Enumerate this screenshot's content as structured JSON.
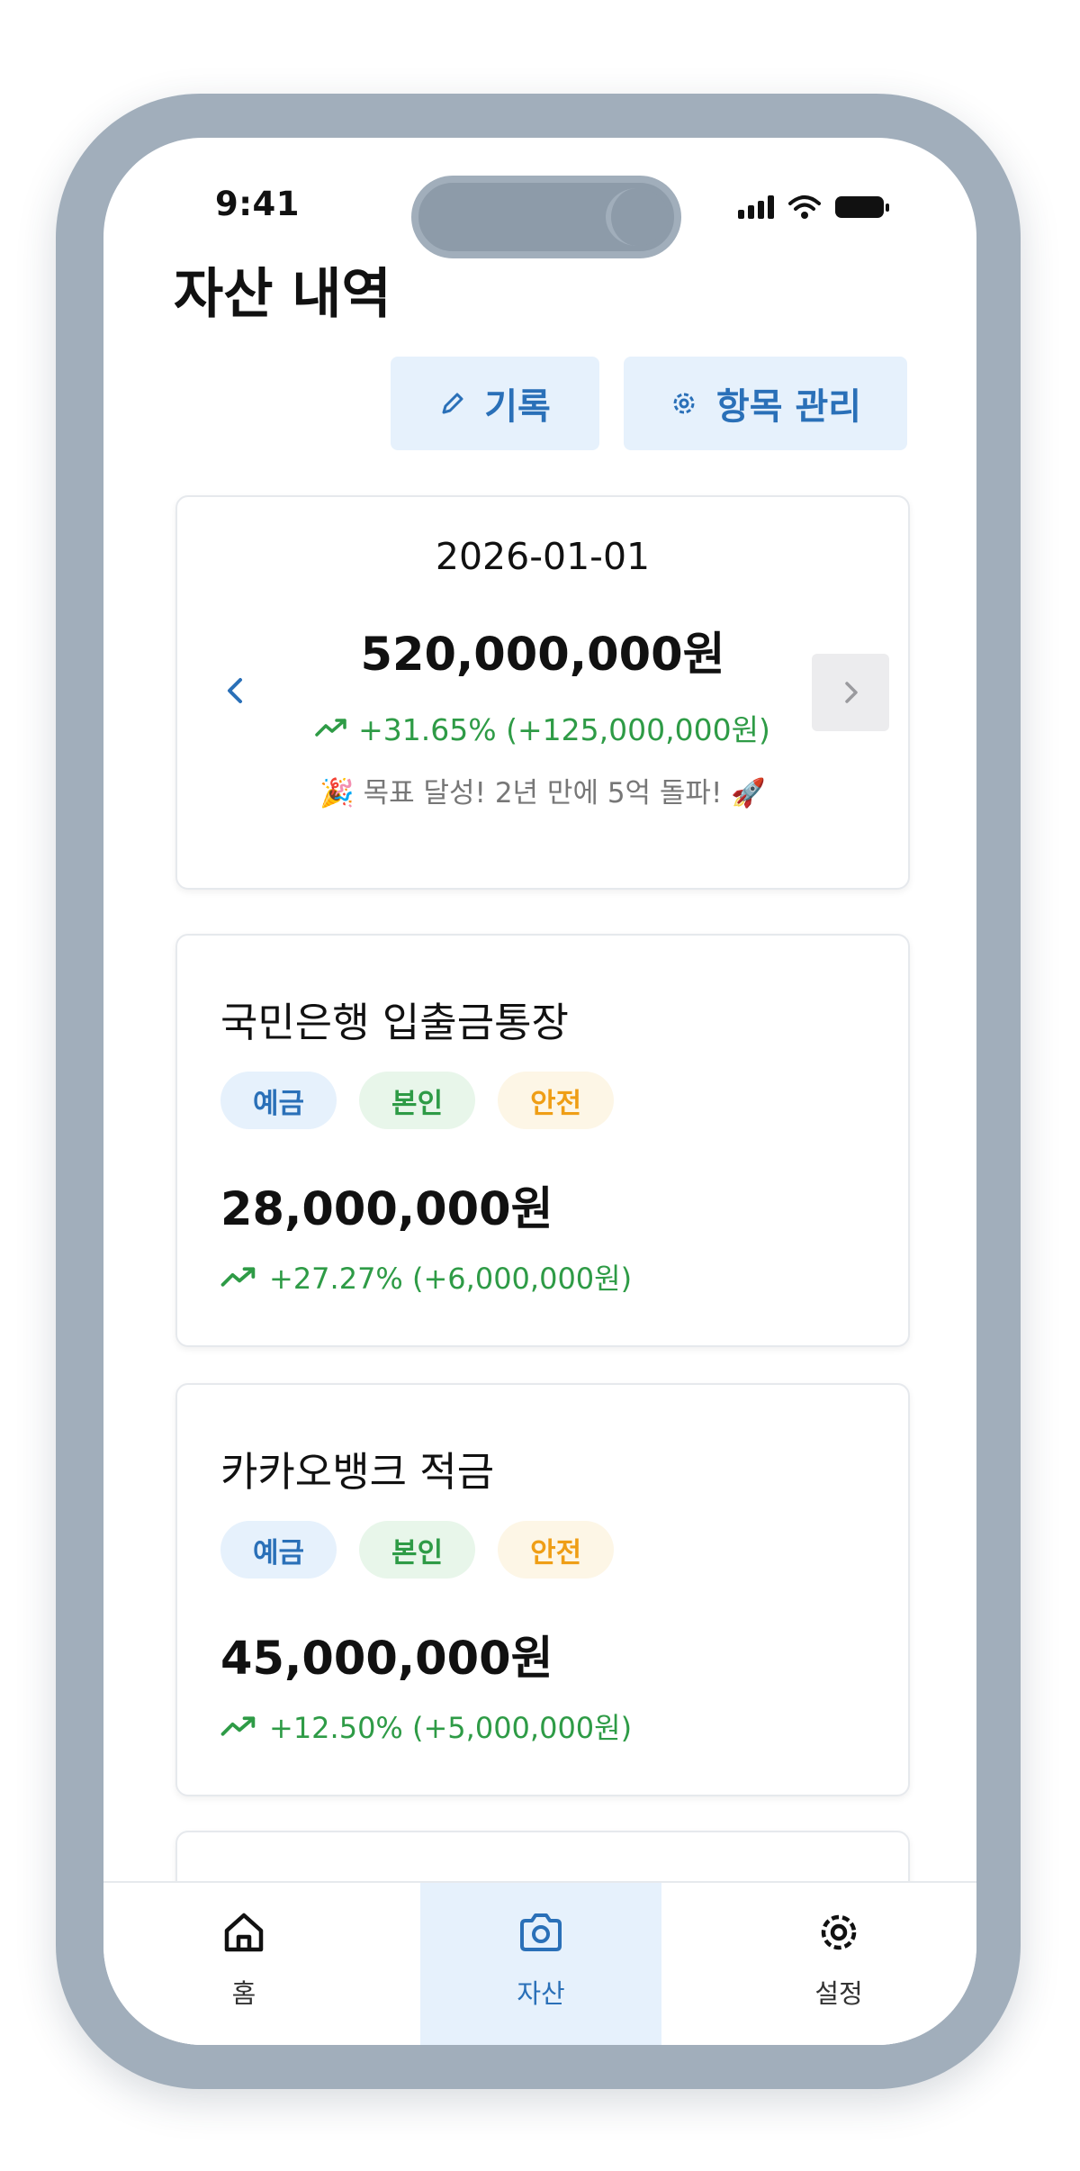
{
  "status_bar": {
    "time": "9:41"
  },
  "header": {
    "title": "자산 내역"
  },
  "actions": {
    "record_label": "기록",
    "manage_label": "항목 관리"
  },
  "summary": {
    "date": "2026-01-01",
    "amount": "520,000,000원",
    "change": "+31.65% (+125,000,000원)",
    "message": "🎉 목표 달성! 2년 만에 5억 돌파! 🚀"
  },
  "assets": [
    {
      "name": "국민은행 입출금통장",
      "tags": [
        "예금",
        "본인",
        "안전"
      ],
      "amount": "28,000,000원",
      "change": "+27.27% (+6,000,000원)"
    },
    {
      "name": "카카오뱅크 적금",
      "tags": [
        "예금",
        "본인",
        "안전"
      ],
      "amount": "45,000,000원",
      "change": "+12.50% (+5,000,000원)"
    }
  ],
  "bottom_nav": {
    "items": [
      {
        "label": "홈",
        "icon": "home-icon"
      },
      {
        "label": "자산",
        "icon": "camera-icon"
      },
      {
        "label": "설정",
        "icon": "gear-icon"
      }
    ],
    "active": "자산"
  },
  "colors": {
    "accent": "#2a70b8",
    "accent_bg": "#e6f1fc",
    "positive": "#2e9b46",
    "warning": "#ef9e16",
    "frame": "#a1aebb"
  }
}
